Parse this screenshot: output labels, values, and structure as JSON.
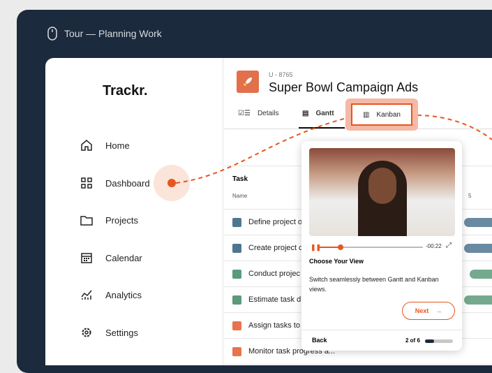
{
  "window": {
    "title": "Tour — Planning Work",
    "icon": "mouse-icon"
  },
  "sidebar": {
    "logo": "Trackr.",
    "items": [
      {
        "label": "Home",
        "icon": "home-icon"
      },
      {
        "label": "Dashboard",
        "icon": "grid-icon"
      },
      {
        "label": "Projects",
        "icon": "folder-icon"
      },
      {
        "label": "Calendar",
        "icon": "calendar-icon"
      },
      {
        "label": "Analytics",
        "icon": "analytics-icon"
      },
      {
        "label": "Settings",
        "icon": "gear-icon"
      }
    ]
  },
  "project": {
    "code": "U - 8765",
    "title": "Super Bowl Campaign Ads",
    "icon": "rocket-icon"
  },
  "tabs": [
    {
      "label": "Details"
    },
    {
      "label": "Gantt",
      "active": true
    },
    {
      "label": "Kanban",
      "highlighted": true
    }
  ],
  "gantt": {
    "header": "Task",
    "column": "Name",
    "day_label": "5",
    "rows": [
      {
        "name": "Define project o",
        "color": "#4f7690"
      },
      {
        "name": "Create project c",
        "color": "#4f7690"
      },
      {
        "name": "Conduct projec",
        "color": "#5c9a7a"
      },
      {
        "name": "Estimate task d",
        "color": "#5c9a7a"
      },
      {
        "name": "Assign tasks to",
        "color": "#e8734f"
      },
      {
        "name": "Monitor task progress a...",
        "color": "#e8734f"
      }
    ]
  },
  "popover": {
    "time": "-00:22",
    "progress": 0.2,
    "heading": "Choose Your View",
    "body": "Switch seamlessly between Gantt and Kanban views.",
    "next": "Next",
    "back": "Back",
    "step": "2 of 6",
    "step_progress": 0.33
  },
  "colors": {
    "accent": "#e8551f",
    "frame": "#1c2a3d"
  }
}
